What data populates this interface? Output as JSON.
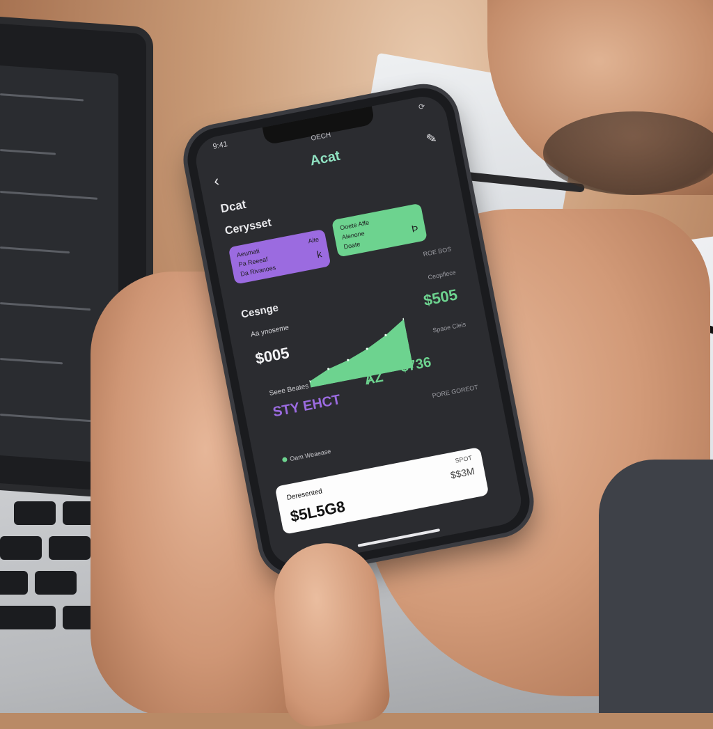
{
  "status": {
    "time": "9:41",
    "center": "ОЕСН"
  },
  "header": {
    "title": "Acat"
  },
  "section1": {
    "title": "Dcat",
    "meta": ""
  },
  "section2": {
    "title": "Cerysset",
    "sub": ""
  },
  "card_purple": {
    "l1": "Aeumati",
    "l2": "Pa Reeeaf",
    "l3": "Da Rivanoes",
    "r1": "Aite",
    "r2": "k"
  },
  "card_green": {
    "l1": "Ooete Affe",
    "l2": "Aienone",
    "l3": "Doate",
    "r1": "",
    "r2": "Þ"
  },
  "misc": {
    "right_small": "ROE BOS"
  },
  "change": {
    "title": "Cesnge",
    "left_label": "Aa ynoseme",
    "left_value": "$005",
    "right_label": "Ceopflece",
    "right_value": "$505",
    "right_label2": "Spaoe Cleis",
    "bottom_label": "Seee Beates",
    "bottom_value_purple": "STY EHCT",
    "bottom_value_green1": "ȺZ",
    "bottom_value_green2": "$736",
    "bottom_small": "PORE GOREOT"
  },
  "bottom": {
    "list_label": "Oam Weaease",
    "card_label": "Deresented",
    "card_small": "SPOT",
    "card_right": "$$3M",
    "card_value": "$5L5G8"
  },
  "chart_data": {
    "type": "area",
    "x": [
      0,
      1,
      2,
      3,
      4,
      5
    ],
    "values": [
      5,
      12,
      16,
      22,
      30,
      40
    ],
    "ylim": [
      0,
      45
    ]
  },
  "colors": {
    "purple": "#9b6be0",
    "green": "#6dd38f",
    "screen": "#2b2c30"
  }
}
